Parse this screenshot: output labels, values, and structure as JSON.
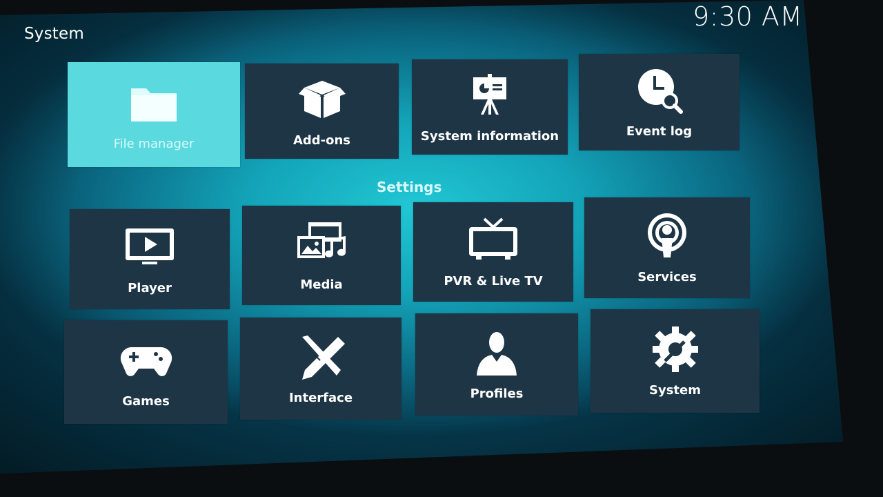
{
  "header": {
    "title": "System",
    "clock": "9:30 AM"
  },
  "top_tiles": [
    {
      "label": "File manager",
      "icon": "folder-icon",
      "focused": true
    },
    {
      "label": "Add-ons",
      "icon": "box-icon"
    },
    {
      "label": "System information",
      "icon": "presentation-easel-icon"
    },
    {
      "label": "Event log",
      "icon": "clock-search-icon"
    }
  ],
  "settings": {
    "title": "Settings",
    "tiles": [
      {
        "label": "Player",
        "icon": "player-screen-icon"
      },
      {
        "label": "Media",
        "icon": "media-icon"
      },
      {
        "label": "PVR & Live TV",
        "icon": "tv-icon"
      },
      {
        "label": "Services",
        "icon": "podcast-icon"
      },
      {
        "label": "Games",
        "icon": "gamepad-icon"
      },
      {
        "label": "Interface",
        "icon": "pencil-ruler-icon"
      },
      {
        "label": "Profiles",
        "icon": "person-icon"
      },
      {
        "label": "System",
        "icon": "gear-wrench-icon"
      }
    ]
  },
  "colors": {
    "tile": "#1d3545",
    "focused_tile": "#5ad9df",
    "background": "#13a3b8"
  }
}
